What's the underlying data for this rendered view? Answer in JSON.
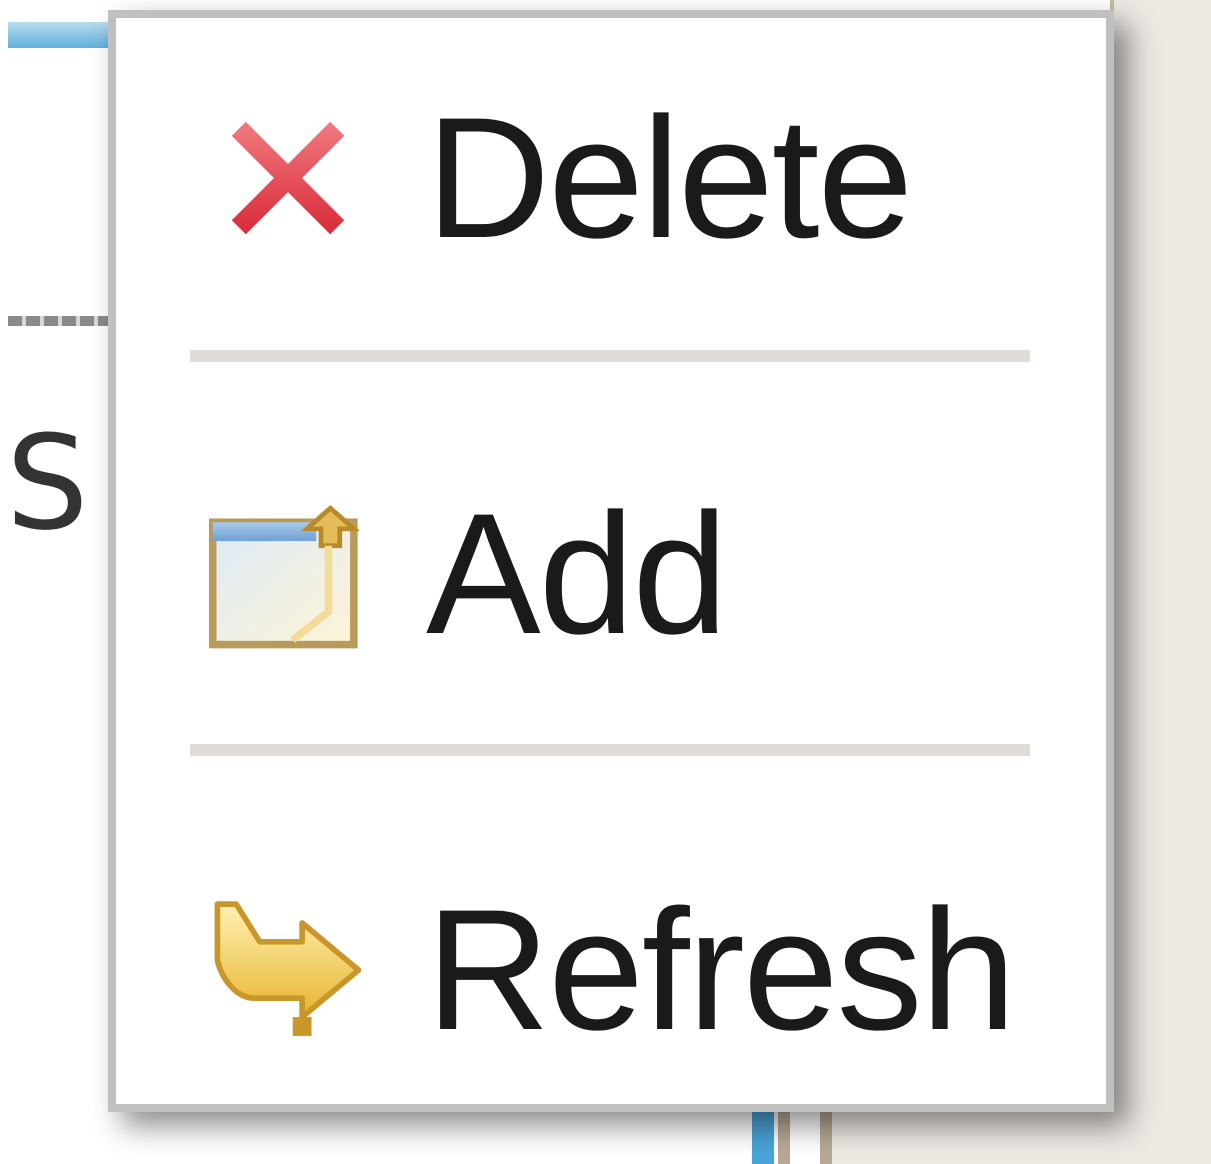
{
  "background": {
    "left_partial_text": "S"
  },
  "context_menu": {
    "items": [
      {
        "label": "Delete",
        "icon": "delete-x-icon",
        "icon_color": "#e0424c"
      },
      {
        "label": "Add",
        "icon": "add-window-icon",
        "icon_color": "#d7b45a"
      },
      {
        "label": "Refresh",
        "icon": "refresh-arrow-icon",
        "icon_color": "#f0c84a"
      }
    ]
  }
}
